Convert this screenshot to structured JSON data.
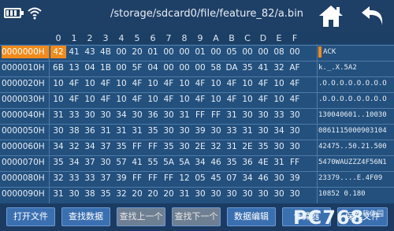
{
  "header": {
    "path": "/storage/sdcard0/file/feature_82/a.bin"
  },
  "columns": [
    "0",
    "1",
    "2",
    "3",
    "4",
    "5",
    "6",
    "7",
    "8",
    "9",
    "A",
    "B",
    "C",
    "D",
    "E",
    "F"
  ],
  "rows": [
    {
      "addr": "0000000H",
      "hex": [
        "42",
        "41",
        "43",
        "4B",
        "00",
        "20",
        "01",
        "00",
        "00",
        "01",
        "00",
        "05",
        "00",
        "00",
        "08",
        "00"
      ],
      "ascii": "ACK"
    },
    {
      "addr": "0000010H",
      "hex": [
        "6B",
        "13",
        "04",
        "1B",
        "00",
        "5F",
        "04",
        "00",
        "00",
        "00",
        "58",
        "DA",
        "35",
        "41",
        "32",
        "AF"
      ],
      "ascii": "k._.X.5A2"
    },
    {
      "addr": "0000020H",
      "hex": [
        "10",
        "4F",
        "10",
        "4F",
        "10",
        "4F",
        "10",
        "4F",
        "10",
        "4F",
        "10",
        "4F",
        "10",
        "4F",
        "10",
        "4F"
      ],
      "ascii": ".O.O.O.O.O.O.O.O"
    },
    {
      "addr": "0000030H",
      "hex": [
        "10",
        "4F",
        "10",
        "4F",
        "10",
        "4F",
        "10",
        "4F",
        "10",
        "4F",
        "10",
        "4F",
        "10",
        "4F",
        "10",
        "4F"
      ],
      "ascii": ".O.O.O.O.O.O.O.O"
    },
    {
      "addr": "0000040H",
      "hex": [
        "31",
        "33",
        "30",
        "30",
        "34",
        "30",
        "36",
        "30",
        "31",
        "FF",
        "FF",
        "31",
        "30",
        "30",
        "33",
        "30"
      ],
      "ascii": "130040601..10030"
    },
    {
      "addr": "0000050H",
      "hex": [
        "30",
        "38",
        "36",
        "31",
        "31",
        "31",
        "35",
        "30",
        "30",
        "39",
        "30",
        "33",
        "31",
        "30",
        "34",
        "30"
      ],
      "ascii": "0861115000903104"
    },
    {
      "addr": "0000060H",
      "hex": [
        "34",
        "32",
        "34",
        "37",
        "35",
        "FF",
        "FF",
        "35",
        "30",
        "2E",
        "32",
        "31",
        "2E",
        "35",
        "30",
        "30"
      ],
      "ascii": "42475..50.21.500"
    },
    {
      "addr": "0000070H",
      "hex": [
        "35",
        "34",
        "37",
        "30",
        "57",
        "41",
        "55",
        "5A",
        "5A",
        "34",
        "46",
        "35",
        "36",
        "4E",
        "31",
        "FF"
      ],
      "ascii": "5470WAUZZZ4F56N1"
    },
    {
      "addr": "0000080H",
      "hex": [
        "32",
        "33",
        "33",
        "37",
        "39",
        "FF",
        "FF",
        "FF",
        "12",
        "05",
        "45",
        "07",
        "34",
        "46",
        "30",
        "39"
      ],
      "ascii": "23379....E.4F09"
    },
    {
      "addr": "0000090H",
      "hex": [
        "31",
        "30",
        "38",
        "35",
        "32",
        "20",
        "20",
        "20",
        "31",
        "30",
        "30",
        "30",
        "30",
        "30",
        "30",
        "30"
      ],
      "ascii": "10852   0.180"
    }
  ],
  "buttons": [
    {
      "label": "打开文件"
    },
    {
      "label": "查找数据"
    },
    {
      "label": "查找上一个"
    },
    {
      "label": "查找下一个"
    },
    {
      "label": "数据编辑"
    },
    {
      "label": "计算器"
    },
    {
      "label": "保存文件"
    }
  ],
  "watermark": {
    "text": "PC768",
    "sub": "软件园"
  },
  "colors": {
    "topbar": "#1e3f66",
    "grid": "#23507d",
    "highlight": "#f28a1a",
    "button": "#3a6fb0"
  }
}
